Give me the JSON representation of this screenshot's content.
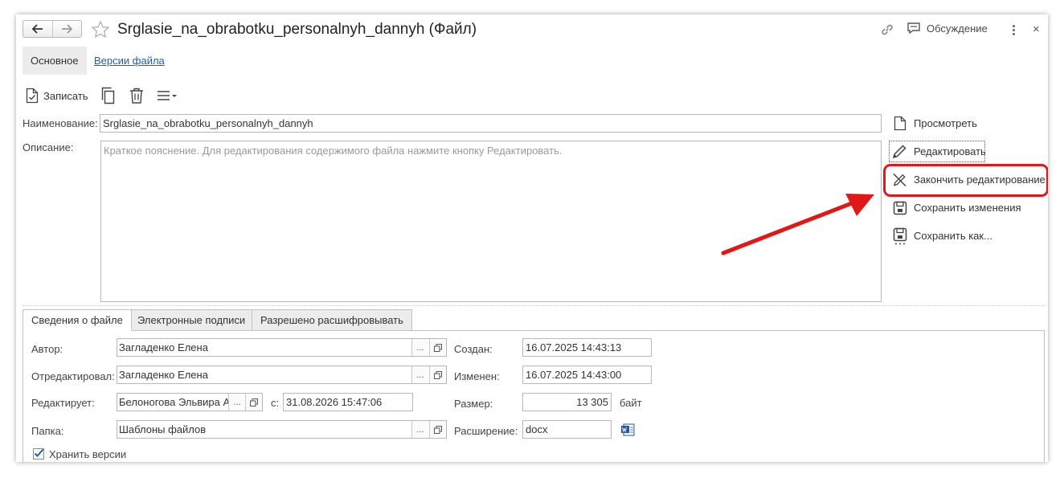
{
  "header": {
    "title": "Srglasie_na_obrabotku_personalnyh_dannyh (Файл)",
    "discuss_label": "Обсуждение",
    "close_glyph": "×"
  },
  "tabs": {
    "main_label": "Основное",
    "versions_label": "Версии файла"
  },
  "toolbar": {
    "write_label": "Записать"
  },
  "form": {
    "name_label": "Наименование:",
    "name_value": "Srglasie_na_obrabotku_personalnyh_dannyh",
    "description_label": "Описание:",
    "description_placeholder": "Краткое пояснение. Для редактирования содержимого файла нажмите кнопку Редактировать."
  },
  "actions": {
    "view": "Просмотреть",
    "edit": "Редактировать",
    "finish_edit": "Закончить редактирование",
    "save_changes": "Сохранить изменения",
    "save_as": "Сохранить как..."
  },
  "bottom_tabs": [
    "Сведения о файле",
    "Электронные подписи",
    "Разрешено расшифровывать"
  ],
  "file_info": {
    "author_label": "Автор:",
    "author_value": "Загладенко Елена",
    "edited_by_label": "Отредактировал:",
    "edited_by_value": "Загладенко Елена",
    "editing_label": "Редактирует:",
    "editing_value": "Белоногова Эльвира А",
    "since_label": "с:",
    "since_value": "31.08.2026 15:47:06",
    "folder_label": "Папка:",
    "folder_value": "Шаблоны файлов",
    "created_label": "Создан:",
    "created_value": "16.07.2025 14:43:13",
    "changed_label": "Изменен:",
    "changed_value": "16.07.2025 14:43:00",
    "size_label": "Размер:",
    "size_value": "13 305",
    "size_unit": "байт",
    "extension_label": "Расширение:",
    "extension_value": "docx",
    "keep_versions_label": "Хранить версии",
    "keep_versions_checked": true,
    "dots": "..."
  },
  "colors": {
    "highlight": "#e01818",
    "link": "#1f5ea8"
  },
  "icons": [
    "back-arrow-icon",
    "forward-arrow-icon",
    "star-icon",
    "link-icon",
    "discussion-icon",
    "more-icon",
    "close-icon",
    "save-doc-icon",
    "copy-icon",
    "trash-icon",
    "menu-icon",
    "file-icon",
    "pencil-icon",
    "finish-edit-icon",
    "floppy-icon",
    "floppy-saveas-icon",
    "open-icon",
    "word-file-icon",
    "checkmark-icon"
  ]
}
